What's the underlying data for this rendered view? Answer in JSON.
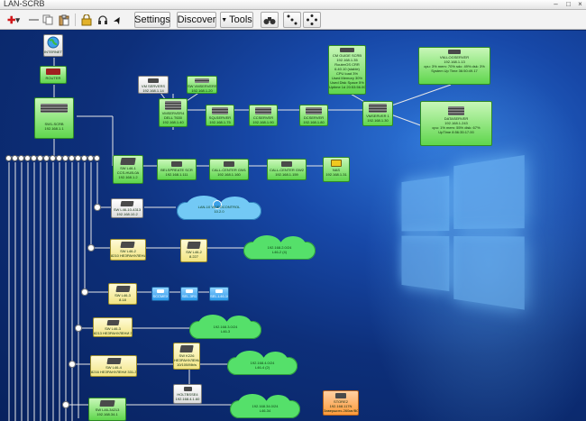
{
  "window": {
    "title": "LAN-SCRB"
  },
  "toolbar": {
    "settings_label": "Settings",
    "discover_label": "Discover",
    "tools_label": "Tools",
    "tools_arrow": "▼",
    "add_symbol": "✚",
    "add_arrow": "▾",
    "cursor_symbol": "➤"
  },
  "map": {
    "nodes": {
      "internet": "INTERNET",
      "router": "ROUTER",
      "core": [
        "SW1-SCRB",
        "192.168.1.1"
      ],
      "vmservs": [
        "VM SERVERS",
        "192.168.1.14"
      ],
      "sw_vm": [
        "SW VMSERVERS",
        "192.168.1.20"
      ],
      "cmguide": [
        "CM GUIDE SCRB",
        "192.168.1.35",
        "RouterOS CRR",
        "6.40.10 (stable)",
        "CPU load 3%",
        "Used Memory 30%",
        "Used Disk Space 5%",
        "Uptime 1d 20:53:56.00"
      ],
      "vmlogserv": [
        "VM-LOGSERVER",
        "192.168.1.13",
        "cpu: 3% mem: 70% sdc: 49% dsk: 3%",
        "System Up Time 36:50:49.17"
      ],
      "databases": [
        "DATASERVER",
        "192.168.1.243",
        "cpu: 1% mem: 55% disk: 67%",
        "UpTime 8:56:35:17.00"
      ],
      "chain": [
        [
          "VMSERVER4",
          "DELL T630",
          "192.168.1.40"
        ],
        [
          "SQLSERVER",
          "192.168.1.75"
        ],
        [
          "CCSERVER",
          "192.168.1.90"
        ],
        [
          "DCSERVER",
          "192.168.1.80"
        ],
        [
          "VMSERVER 1",
          "192.168.1.30"
        ]
      ],
      "sw_l46": [
        "SW L46-1",
        "CCS-HUB-0A",
        "192.168.1.2"
      ],
      "belspeq": [
        "BELSPREATE SCR",
        "192.168.1.111"
      ],
      "callcenter1": [
        "CALL-CENTER GW1",
        "192.168.1.160"
      ],
      "callcenter2": [
        "CALL-CENTER GW2",
        "192.168.1.159"
      ],
      "nas": [
        "NAS",
        "192.168.1.31"
      ],
      "sw_l46_c": [
        "SW L46-10-4313",
        "192.168.10.2"
      ],
      "lan_videocontrol": [
        "LAN-10 VIDEOCONTROL",
        "10.2.0"
      ],
      "sw_l46_2": [
        "SW L46-2",
        "8210 НЕЗРАНУЛЕНИ"
      ],
      "sw_l46_2b": [
        "SW L46-2",
        "8.227"
      ],
      "cloud_2": [
        "192.168.2.0/24",
        "L46-2 (4)"
      ],
      "sw_l46_3": [
        "SW L46-3",
        "8.18"
      ],
      "blue1": "SCCMEX",
      "blue2": "SEL-3R1",
      "blue3": "SEL-L46-10",
      "sw_l46_4": [
        "SW L46-3",
        "8213 НЕЗРАНУЛЕНИ 301-309"
      ],
      "cloud_3": [
        "192.168.3.0/24",
        "L46-3"
      ],
      "sw_k226": [
        "SW K226",
        "НЕЗРАНУЛЕНИ",
        "10/100/Mb/s"
      ],
      "sw_l46_5": [
        "SW L46-4",
        "8216 НЕЗРАНУЛЕНИ 331-34"
      ],
      "cloud_4": [
        "192.168.4.0/24",
        "L46-4 (2)"
      ],
      "host_x": [
        "HOLTBSSE4",
        "192.168.4.1.60"
      ],
      "sw_l46_6": [
        "SW L46-34213",
        "192.168.34.1"
      ],
      "cloud_34": [
        "192.168.34.0/24",
        "L46-34"
      ],
      "storage": [
        "STORE2",
        "192.168.117N",
        "Завершить 260мг/ВО"
      ]
    }
  }
}
